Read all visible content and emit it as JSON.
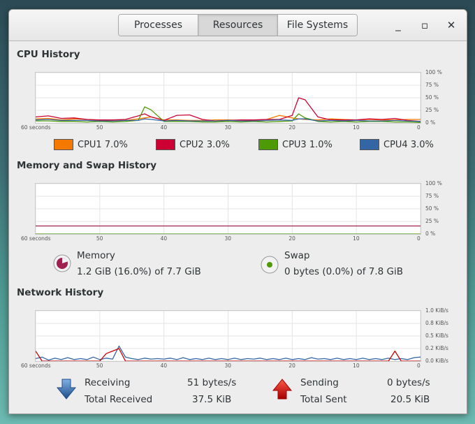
{
  "tabs": [
    {
      "label": "Processes",
      "active": false
    },
    {
      "label": "Resources",
      "active": true
    },
    {
      "label": "File Systems",
      "active": false
    }
  ],
  "window_controls": {
    "minimize": "_",
    "maximize": "▫",
    "close": "✕"
  },
  "cpu": {
    "title": "CPU History",
    "x_ticks": [
      "60 seconds",
      "50",
      "40",
      "30",
      "20",
      "10",
      "0"
    ],
    "y_ticks": [
      "100 %",
      "75 %",
      "50 %",
      "25 %",
      "0 %"
    ],
    "legend": [
      {
        "label": "CPU1",
        "value": "7.0%",
        "color": "#f57900"
      },
      {
        "label": "CPU2",
        "value": "3.0%",
        "color": "#cc0033"
      },
      {
        "label": "CPU3",
        "value": "1.0%",
        "color": "#4e9a06"
      },
      {
        "label": "CPU4",
        "value": "3.0%",
        "color": "#3465a4"
      }
    ]
  },
  "memory": {
    "title": "Memory and Swap History",
    "x_ticks": [
      "60 seconds",
      "50",
      "40",
      "30",
      "20",
      "10",
      "0"
    ],
    "y_ticks": [
      "100 %",
      "75 %",
      "50 %",
      "25 %",
      "0 %"
    ],
    "memory_label": "Memory",
    "memory_value": "1.2 GiB (16.0%) of 7.7 GiB",
    "swap_label": "Swap",
    "swap_value": "0 bytes (0.0%) of 7.8 GiB",
    "memory_color": "#a0204f",
    "swap_color": "#4e9a06"
  },
  "network": {
    "title": "Network History",
    "x_ticks": [
      "60 seconds",
      "50",
      "40",
      "30",
      "20",
      "10",
      "0"
    ],
    "y_ticks": [
      "1.0 KiB/s",
      "0.8 KiB/s",
      "0.5 KiB/s",
      "0.2 KiB/s",
      "0.0 KiB/s"
    ],
    "receiving_label": "Receiving",
    "receiving_value": "51 bytes/s",
    "total_received_label": "Total Received",
    "total_received_value": "37.5 KiB",
    "sending_label": "Sending",
    "sending_value": "0 bytes/s",
    "total_sent_label": "Total Sent",
    "total_sent_value": "20.5 KiB",
    "receiving_color": "#3465a4",
    "sending_color": "#cc0000"
  },
  "chart_data": [
    {
      "type": "line",
      "title": "CPU History",
      "x": [
        60,
        58,
        56,
        54,
        52,
        50,
        48,
        46,
        44,
        43,
        42,
        40,
        38,
        36,
        34,
        32,
        30,
        28,
        26,
        24,
        22,
        20,
        19,
        18,
        16,
        14,
        12,
        10,
        8,
        6,
        4,
        2,
        0
      ],
      "series": [
        {
          "name": "CPU1",
          "values": [
            8,
            9,
            6,
            8,
            7,
            5,
            6,
            5,
            8,
            10,
            12,
            6,
            6,
            5,
            5,
            6,
            6,
            5,
            5,
            7,
            15,
            10,
            8,
            7,
            6,
            8,
            7,
            6,
            7,
            6,
            6,
            7,
            7
          ]
        },
        {
          "name": "CPU2",
          "values": [
            12,
            14,
            9,
            10,
            7,
            6,
            6,
            7,
            14,
            18,
            12,
            5,
            15,
            16,
            7,
            4,
            5,
            6,
            6,
            7,
            7,
            15,
            50,
            46,
            12,
            6,
            6,
            6,
            8,
            7,
            9,
            5,
            3
          ]
        },
        {
          "name": "CPU3",
          "values": [
            4,
            4,
            3,
            3,
            2,
            3,
            2,
            3,
            5,
            32,
            26,
            3,
            3,
            3,
            2,
            2,
            3,
            2,
            3,
            2,
            3,
            4,
            18,
            10,
            3,
            2,
            3,
            2,
            3,
            3,
            2,
            2,
            1
          ]
        },
        {
          "name": "CPU4",
          "values": [
            6,
            7,
            5,
            5,
            5,
            4,
            4,
            5,
            5,
            8,
            7,
            4,
            5,
            4,
            4,
            4,
            5,
            4,
            4,
            5,
            6,
            5,
            8,
            8,
            4,
            5,
            4,
            5,
            4,
            4,
            5,
            4,
            3
          ]
        }
      ],
      "ylim": [
        0,
        100
      ]
    },
    {
      "type": "line",
      "title": "Memory and Swap History",
      "x": [
        60,
        0
      ],
      "series": [
        {
          "name": "Memory",
          "values": [
            16,
            16
          ]
        },
        {
          "name": "Swap",
          "values": [
            0,
            0
          ]
        }
      ],
      "ylim": [
        0,
        100
      ]
    },
    {
      "type": "line",
      "title": "Network History",
      "x": [
        60,
        59,
        58,
        57,
        56,
        55,
        54,
        53,
        52,
        51,
        50,
        49,
        48,
        47,
        46,
        45,
        44,
        43,
        42,
        41,
        40,
        39,
        38,
        37,
        36,
        35,
        34,
        33,
        32,
        31,
        30,
        29,
        28,
        27,
        26,
        25,
        24,
        23,
        22,
        21,
        20,
        19,
        18,
        17,
        16,
        15,
        14,
        13,
        12,
        11,
        10,
        9,
        8,
        7,
        6,
        5,
        4,
        3,
        2,
        1,
        0
      ],
      "series": [
        {
          "name": "Receiving",
          "values": [
            0.05,
            0.08,
            0.02,
            0.06,
            0.03,
            0.07,
            0.03,
            0.05,
            0.03,
            0.08,
            0.03,
            0.06,
            0.04,
            0.3,
            0.08,
            0.05,
            0.03,
            0.06,
            0.04,
            0.05,
            0.04,
            0.06,
            0.03,
            0.07,
            0.03,
            0.05,
            0.03,
            0.06,
            0.03,
            0.05,
            0.03,
            0.06,
            0.03,
            0.05,
            0.04,
            0.06,
            0.03,
            0.05,
            0.03,
            0.06,
            0.03,
            0.05,
            0.03,
            0.07,
            0.04,
            0.05,
            0.03,
            0.06,
            0.03,
            0.05,
            0.03,
            0.06,
            0.03,
            0.05,
            0.03,
            0.06,
            0.03,
            0.05,
            0.03,
            0.07,
            0.08
          ]
        },
        {
          "name": "Sending",
          "values": [
            0.2,
            0.0,
            0.0,
            0.0,
            0.0,
            0.0,
            0.0,
            0.0,
            0.0,
            0.0,
            0.0,
            0.15,
            0.2,
            0.25,
            0.0,
            0.0,
            0.0,
            0.0,
            0.0,
            0.0,
            0.0,
            0.0,
            0.0,
            0.0,
            0.0,
            0.0,
            0.0,
            0.0,
            0.0,
            0.0,
            0.0,
            0.0,
            0.0,
            0.0,
            0.0,
            0.0,
            0.0,
            0.0,
            0.0,
            0.0,
            0.0,
            0.0,
            0.0,
            0.0,
            0.0,
            0.0,
            0.0,
            0.0,
            0.0,
            0.0,
            0.0,
            0.0,
            0.0,
            0.0,
            0.0,
            0.0,
            0.2,
            0.0,
            0.0,
            0.0,
            0.0
          ]
        }
      ],
      "ylim": [
        0,
        1.0
      ]
    }
  ]
}
